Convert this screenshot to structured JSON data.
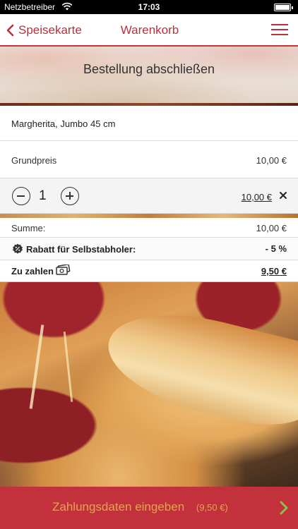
{
  "status_bar": {
    "carrier": "Netzbetreiber",
    "time": "17:03",
    "icons": [
      "wifi-icon",
      "battery-icon"
    ]
  },
  "navbar": {
    "back_label": "Speisekarte",
    "title": "Warenkorb",
    "icons": [
      "chevron-left-icon",
      "hamburger-menu-icon"
    ]
  },
  "banner": {
    "title": "Bestellung abschließen"
  },
  "cart": {
    "item_name": "Margherita, Jumbo 45 cm",
    "base_price_label": "Grundpreis",
    "base_price_value": "10,00 €",
    "quantity": "1",
    "line_total": "10,00 €"
  },
  "summary": {
    "sum_label": "Summe:",
    "sum_value": "10,00 €",
    "discount_label": "Rabatt für Selbstabholer:",
    "discount_value": "- 5 %",
    "pay_label": "Zu zahlen",
    "pay_value": "9,50 €"
  },
  "cta": {
    "label": "Zahlungsdaten eingeben",
    "amount": "(9,50 €)"
  },
  "colors": {
    "brand_red": "#c2313c",
    "nav_red": "#b8313b",
    "cta_text": "#e1a74b",
    "cta_arrow": "#8fbf4a"
  }
}
